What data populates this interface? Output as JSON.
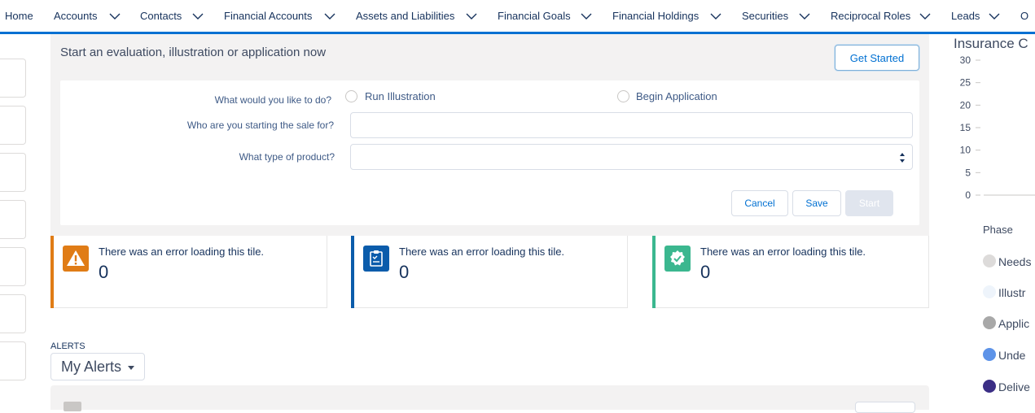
{
  "nav": {
    "items": [
      {
        "label": "Home"
      },
      {
        "label": "Accounts"
      },
      {
        "label": "Contacts"
      },
      {
        "label": "Financial Accounts"
      },
      {
        "label": "Assets and Liabilities"
      },
      {
        "label": "Financial Goals"
      },
      {
        "label": "Financial Holdings"
      },
      {
        "label": "Securities"
      },
      {
        "label": "Reciprocal Roles"
      },
      {
        "label": "Leads"
      },
      {
        "label": "O"
      }
    ],
    "accent": "#0070d2"
  },
  "sale_card": {
    "title": "Start an evaluation, illustration or application now",
    "get_started_label": "Get Started",
    "q_action": "What would you like to do?",
    "option_run": "Run Illustration",
    "option_begin": "Begin Application",
    "q_who": "Who are you starting the sale for?",
    "who_value": "",
    "q_product": "What type of product?",
    "product_value": "",
    "cancel_label": "Cancel",
    "save_label": "Save",
    "start_label": "Start"
  },
  "tiles": [
    {
      "message": "There was an error loading this tile.",
      "count": "0",
      "color": "#e07c16",
      "icon": "warning-icon"
    },
    {
      "message": "There was an error loading this tile.",
      "count": "0",
      "color": "#0b5cab",
      "icon": "clipboard-icon"
    },
    {
      "message": "There was an error loading this tile.",
      "count": "0",
      "color": "#3bb78f",
      "icon": "badge-check-icon"
    }
  ],
  "alerts": {
    "heading": "ALERTS",
    "dropdown_label": "My Alerts"
  },
  "chart": {
    "title": "Insurance C",
    "legend_title": "Phase",
    "legend": [
      {
        "label": "Needs",
        "color": "#dddbda"
      },
      {
        "label": "Illustr",
        "color": "#eef4fb"
      },
      {
        "label": "Applic",
        "color": "#a8a8a8"
      },
      {
        "label": "Unde",
        "color": "#5d93e8"
      },
      {
        "label": "Delive",
        "color": "#3b2e85"
      }
    ]
  },
  "chart_data": {
    "type": "bar",
    "title": "Insurance C",
    "ylim": [
      0,
      30
    ],
    "y_ticks": [
      "30",
      "25",
      "20",
      "15",
      "10",
      "5",
      "0"
    ],
    "categories": [],
    "values": [],
    "legend_title": "Phase",
    "legend_position": "right"
  }
}
